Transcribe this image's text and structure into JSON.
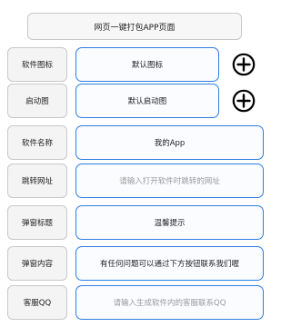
{
  "header": {
    "title": "网页一键打包APP页面"
  },
  "rows": [
    {
      "label": "软件图标",
      "value": "默认图标",
      "action_icon": "plus-circle-icon"
    },
    {
      "label": "启动图",
      "value": "默认启动图",
      "action_icon": "plus-circle-icon"
    },
    {
      "label": "软件名称",
      "value": "我的App"
    },
    {
      "label": "跳转网址",
      "placeholder": "请输入打开软件时跳转的网址"
    },
    {
      "label": "弹窗标题",
      "value": "温馨提示"
    },
    {
      "label": "弹窗内容",
      "value": "有任何问题可以通过下方按钮联系我们喔"
    },
    {
      "label": "客服QQ",
      "placeholder": "请输入生成软件内的客服联系QQ"
    }
  ],
  "colors": {
    "accent_border": "#2f7de1",
    "label_border": "#c8c8c8",
    "placeholder_text": "#9a9a9a"
  }
}
